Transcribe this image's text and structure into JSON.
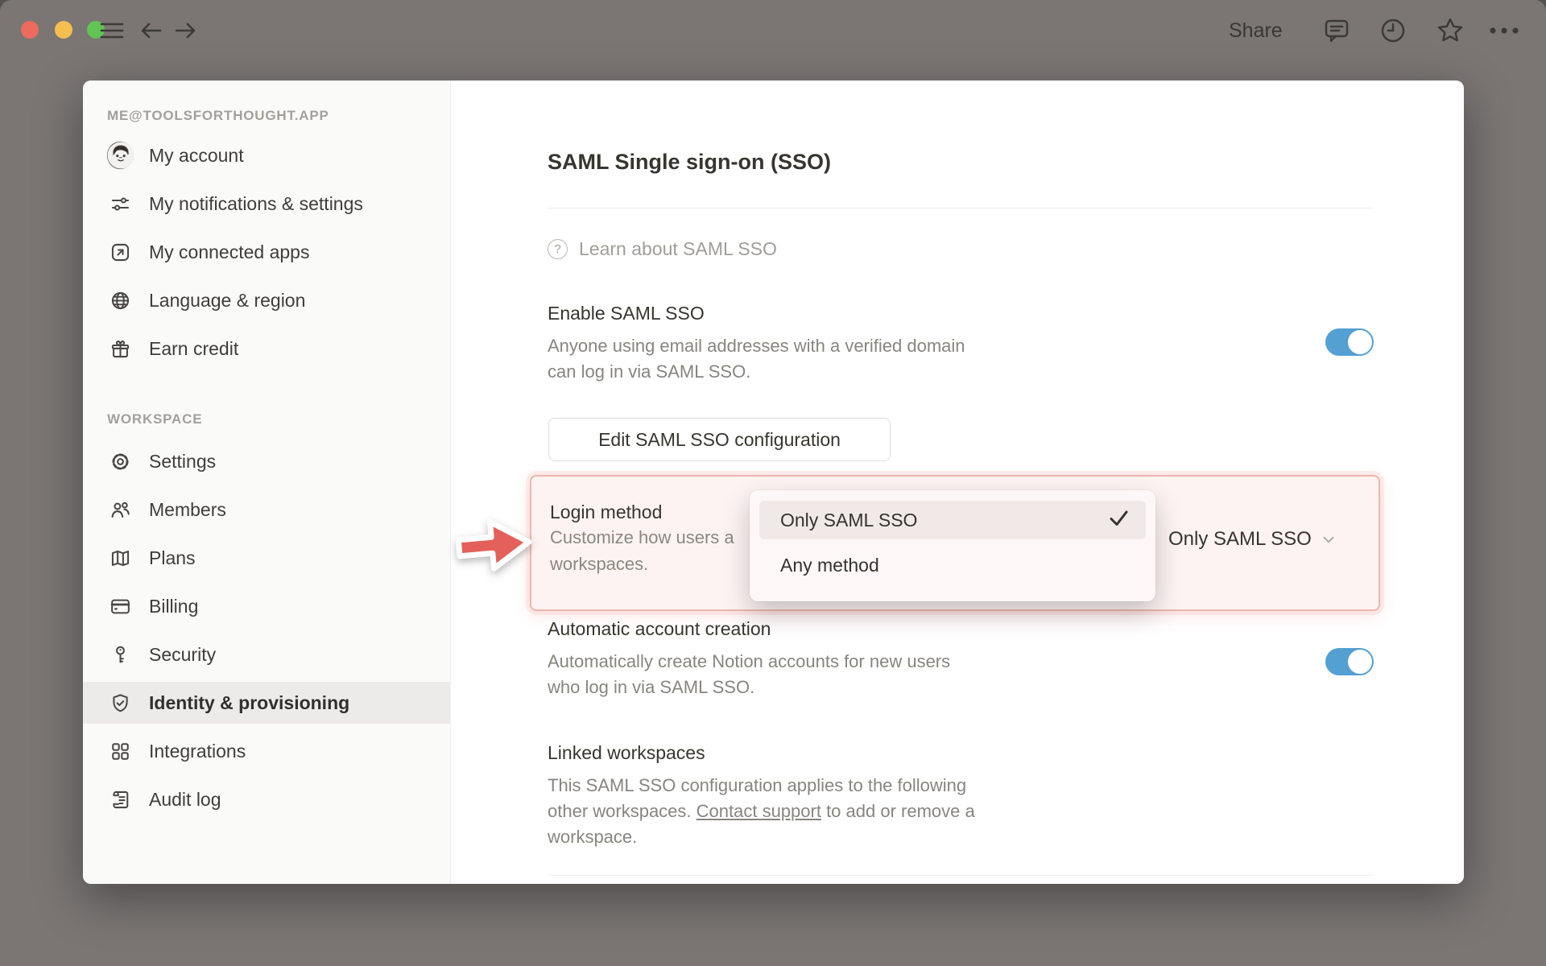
{
  "colors": {
    "accent_blue": "#54a0d3",
    "highlight_border": "#eeb6b0",
    "highlight_bg": "#fdf3f2",
    "arrow_red": "#e4605a",
    "traffic_red": "#ed6a5e",
    "traffic_yellow": "#f5bf4f",
    "traffic_green": "#61c454"
  },
  "titlebar": {
    "share_label": "Share",
    "icons": [
      "hamburger-icon",
      "back-icon",
      "forward-icon",
      "comment-icon",
      "clock-icon",
      "star-icon",
      "ellipsis-icon"
    ]
  },
  "sidebar": {
    "account_heading": "ME@TOOLSFORTHOUGHT.APP",
    "account_items": [
      {
        "label": "My account",
        "icon": "avatar"
      },
      {
        "label": "My notifications & settings",
        "icon": "sliders-icon"
      },
      {
        "label": "My connected apps",
        "icon": "external-link-icon"
      },
      {
        "label": "Language & region",
        "icon": "globe-icon"
      },
      {
        "label": "Earn credit",
        "icon": "gift-icon"
      }
    ],
    "workspace_heading": "WORKSPACE",
    "workspace_items": [
      {
        "label": "Settings",
        "icon": "gear-icon",
        "active": false
      },
      {
        "label": "Members",
        "icon": "members-icon",
        "active": false
      },
      {
        "label": "Plans",
        "icon": "map-icon",
        "active": false
      },
      {
        "label": "Billing",
        "icon": "credit-card-icon",
        "active": false
      },
      {
        "label": "Security",
        "icon": "key-icon",
        "active": false
      },
      {
        "label": "Identity & provisioning",
        "icon": "shield-check-icon",
        "active": true
      },
      {
        "label": "Integrations",
        "icon": "grid-icon",
        "active": false
      },
      {
        "label": "Audit log",
        "icon": "audit-log-icon",
        "active": false
      }
    ]
  },
  "main": {
    "title": "SAML Single sign-on (SSO)",
    "learn_link": "Learn about SAML SSO",
    "enable": {
      "heading": "Enable SAML SSO",
      "description": "Anyone using email addresses with a verified domain can log in via SAML SSO.",
      "toggle_on": true
    },
    "edit_button": "Edit SAML SSO configuration",
    "login_method": {
      "heading": "Login method",
      "description_visible_line1": "Customize how users a",
      "description_visible_line2": "workspaces.",
      "selected_value": "Only SAML SSO"
    },
    "login_dropdown": {
      "items": [
        {
          "label": "Only SAML SSO",
          "selected": true
        },
        {
          "label": "Any method",
          "selected": false
        }
      ]
    },
    "auto_account": {
      "heading": "Automatic account creation",
      "description": "Automatically create Notion accounts for new users who log in via SAML SSO.",
      "toggle_on": true
    },
    "linked": {
      "heading": "Linked workspaces",
      "description_before": "This SAML SSO configuration applies to the following other workspaces. ",
      "link_text": "Contact support",
      "description_after": " to add or remove a workspace."
    }
  }
}
